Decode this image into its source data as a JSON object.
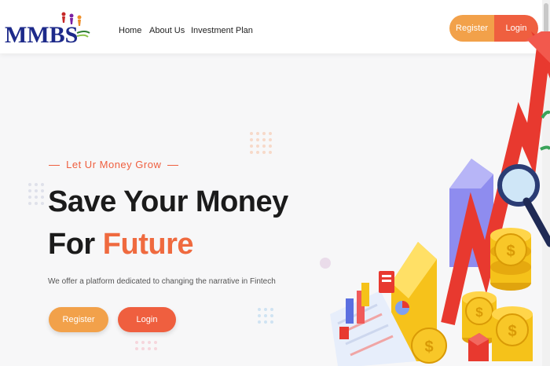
{
  "brand": {
    "name": "MMBS"
  },
  "nav": {
    "items": [
      "Home",
      "About Us",
      "Investment Plan"
    ]
  },
  "header": {
    "register_label": "Register",
    "login_label": "Login"
  },
  "hero": {
    "tagline": "Let Ur Money Grow",
    "title_line1": "Save Your Money",
    "title_line2_prefix": "For ",
    "title_line2_accent": "Future",
    "subtitle": "We offer a platform dedicated to changing the narrative in Fintech",
    "register_label": "Register",
    "login_label": "Login"
  },
  "colors": {
    "brand_blue": "#1d2a8a",
    "accent_orange": "#f2a14a",
    "accent_red": "#ef5f3f",
    "arrow_red": "#e8392f",
    "coin_gold": "#f5c21a"
  }
}
